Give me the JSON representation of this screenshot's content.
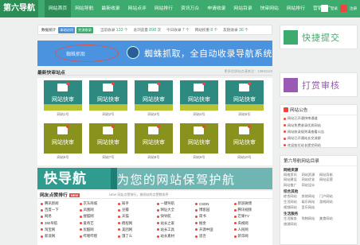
{
  "brand": {
    "logo": "第六导航"
  },
  "nav": [
    "网站首页",
    "网站导航",
    "最新收录",
    "网站点评",
    "网站排行",
    "资讯万众",
    "申请收录",
    "网站目录",
    "快审网站",
    "网站排行",
    "营销推广"
  ],
  "top_right": {
    "login": "登录",
    "register": "注册"
  },
  "stats": {
    "label": "数据统计",
    "tags": [
      "本站访问",
      "交流收录"
    ],
    "items": [
      {
        "label": "当前收录",
        "value": "133",
        "unit": "个"
      },
      {
        "label": "总浏览量",
        "value": "898",
        "unit": "次"
      },
      {
        "label": "今日收录",
        "value": "7",
        "unit": "个"
      },
      {
        "label": "网站权重",
        "value": "8",
        "unit": "个"
      },
      {
        "label": "友链收录",
        "value": "36",
        "unit": "个"
      }
    ]
  },
  "spider_banner": {
    "oval_text": "蜘蛛抓取",
    "text": "蜘蛛抓取，全自动收录导航系统"
  },
  "latest": {
    "title": "最新快审站点",
    "note": "更多优质站点请关注：13943123"
  },
  "cards": [
    {
      "title": "网站快审",
      "caption": "网站1号"
    },
    {
      "title": "网站快审",
      "caption": "网站2号"
    },
    {
      "title": "网站快审",
      "caption": "网站3号"
    },
    {
      "title": "网站快审",
      "caption": "网站4号"
    },
    {
      "title": "网站快审",
      "caption": "网站5号"
    },
    {
      "title": "网站快审",
      "caption": "网站6号"
    },
    {
      "title": "网站快审",
      "caption": "网站7号"
    },
    {
      "title": "网站快审",
      "caption": "网站8号"
    },
    {
      "title": "网站快审",
      "caption": "网站9号"
    },
    {
      "title": "网站快审",
      "caption": "网站10号"
    }
  ],
  "kd_banner": {
    "left": "快导航",
    "right": "为您的网站保驾护航"
  },
  "friendly": {
    "title": "网友点赞排行",
    "tag": "NEW",
    "note": "NEW 网友点赞排行，按网站的点赞数排序",
    "columns": [
      [
        "腾讯新闻",
        "百度一下",
        "网易",
        "360导航",
        "淘宝网",
        "新浪网"
      ],
      [
        "京东商城",
        "凤凰网",
        "搜狐网",
        "爱奇艺",
        "优酷网",
        "哔哩哔哩"
      ],
      [
        "知乎",
        "豆瓣",
        "天猫",
        "携程网",
        "美团网",
        "饿了么"
      ],
      [
        "一键导航",
        "网址大全",
        "快导航",
        "站长之家",
        "站长工具",
        "站长素材"
      ],
      [
        "CSDN",
        "博客园",
        "简书",
        "掘金",
        "开源中国",
        "思否"
      ],
      [
        "新浪微博",
        "腾讯视频",
        "芒果TV",
        "央视网",
        "人民网",
        "新华网"
      ]
    ]
  },
  "side": {
    "submit": "快捷提交",
    "audit": "打赏审核",
    "notice": {
      "title": "网站公告",
      "items": [
        "网站已开通快审通道",
        "网站免费收录优质网站",
        "网站收录规则请查看公告",
        "网站已开通站长交流群",
        "欢迎各位站长提交网站"
      ]
    },
    "directory": {
      "title": "第六导航网站目录",
      "groups": [
        {
          "name": "网络资源",
          "items": [
            "网络资讯",
            "网站资源",
            "网站导航",
            "网站建设",
            "网站优化",
            "网站运营",
            "网站推广",
            "网站设计"
          ]
        },
        {
          "name": "综合其他",
          "items": [
            "综合网站",
            "其他网站",
            "门户网站",
            "生活网站",
            "娱乐网站",
            "游戏网站",
            "视频网站",
            "音乐网站"
          ]
        },
        {
          "name": "生活服务",
          "items": [
            "生活服务",
            "购物网站",
            "美食网站",
            "旅游网站"
          ]
        }
      ]
    }
  }
}
